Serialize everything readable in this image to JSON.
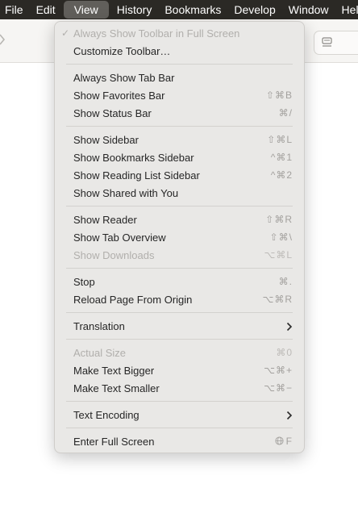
{
  "menubar": {
    "items": [
      {
        "label": "File"
      },
      {
        "label": "Edit"
      },
      {
        "label": "View",
        "active": true
      },
      {
        "label": "History"
      },
      {
        "label": "Bookmarks"
      },
      {
        "label": "Develop"
      },
      {
        "label": "Window"
      },
      {
        "label": "Help"
      }
    ]
  },
  "colors": {
    "menubar_bg": "#2b2925",
    "menubar_active": "#615f5b",
    "menu_bg": "#e9e8e6",
    "separator": "#d3d1ce",
    "disabled_text": "#b1afac"
  },
  "view_menu": {
    "items": [
      {
        "label": "Always Show Toolbar in Full Screen",
        "disabled": true,
        "checked": true
      },
      {
        "label": "Customize Toolbar…"
      },
      {
        "label": "Always Show Tab Bar"
      },
      {
        "label": "Show Favorites Bar",
        "shortcut": "⇧⌘B"
      },
      {
        "label": "Show Status Bar",
        "shortcut": "⌘/"
      },
      {
        "label": "Show Sidebar",
        "shortcut": "⇧⌘L"
      },
      {
        "label": "Show Bookmarks Sidebar",
        "shortcut": "^⌘1"
      },
      {
        "label": "Show Reading List Sidebar",
        "shortcut": "^⌘2"
      },
      {
        "label": "Show Shared with You"
      },
      {
        "label": "Show Reader",
        "shortcut": "⇧⌘R"
      },
      {
        "label": "Show Tab Overview",
        "shortcut": "⇧⌘\\"
      },
      {
        "label": "Show Downloads",
        "shortcut": "⌥⌘L",
        "disabled": true
      },
      {
        "label": "Stop",
        "shortcut": "⌘."
      },
      {
        "label": "Reload Page From Origin",
        "shortcut": "⌥⌘R"
      },
      {
        "label": "Translation",
        "submenu": true
      },
      {
        "label": "Actual Size",
        "shortcut": "⌘0",
        "disabled": true
      },
      {
        "label": "Make Text Bigger",
        "shortcut": "⌥⌘+"
      },
      {
        "label": "Make Text Smaller",
        "shortcut": "⌥⌘−"
      },
      {
        "label": "Text Encoding",
        "submenu": true
      },
      {
        "label": "Enter Full Screen",
        "shortcut": "F",
        "shortcut_icon": "globe-icon"
      }
    ]
  }
}
